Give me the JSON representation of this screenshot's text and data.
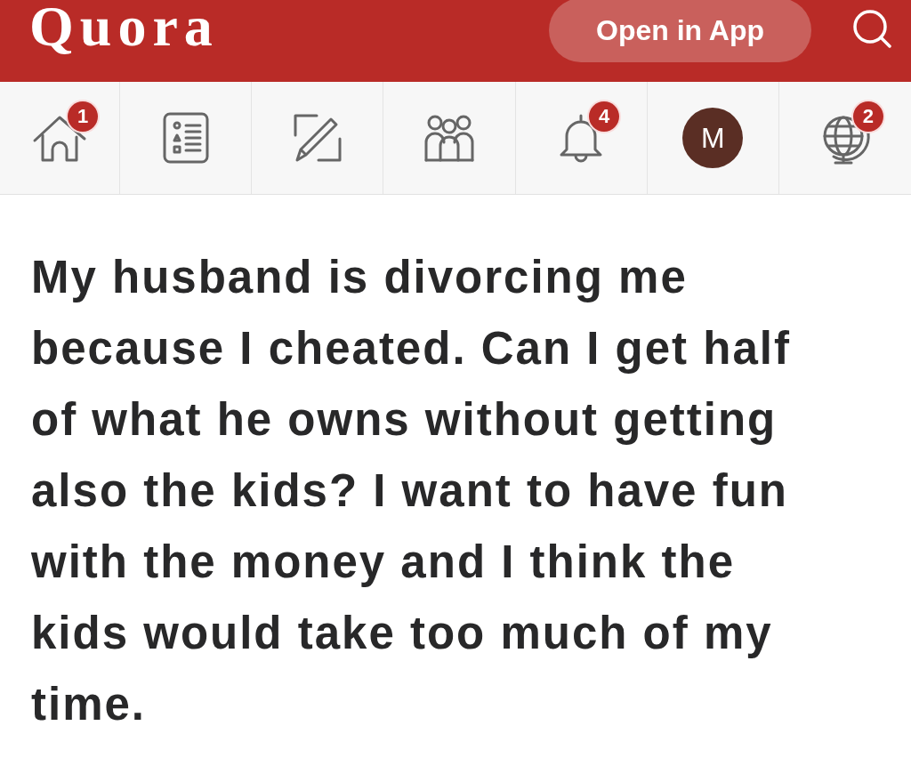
{
  "header": {
    "logo": "Quora",
    "open_app_button": "Open in App"
  },
  "nav": {
    "items": [
      {
        "kind": "home",
        "badge": "1"
      },
      {
        "kind": "list"
      },
      {
        "kind": "edit"
      },
      {
        "kind": "people"
      },
      {
        "kind": "bell",
        "badge": "4"
      },
      {
        "kind": "avatar",
        "initial": "M"
      },
      {
        "kind": "globe",
        "badge": "2"
      }
    ]
  },
  "question": {
    "text": "My husband is divorcing me because I cheated. Can I get half of what he owns without getting also the kids? I want to have fun with the money and I think the kids would take too much of my time."
  }
}
